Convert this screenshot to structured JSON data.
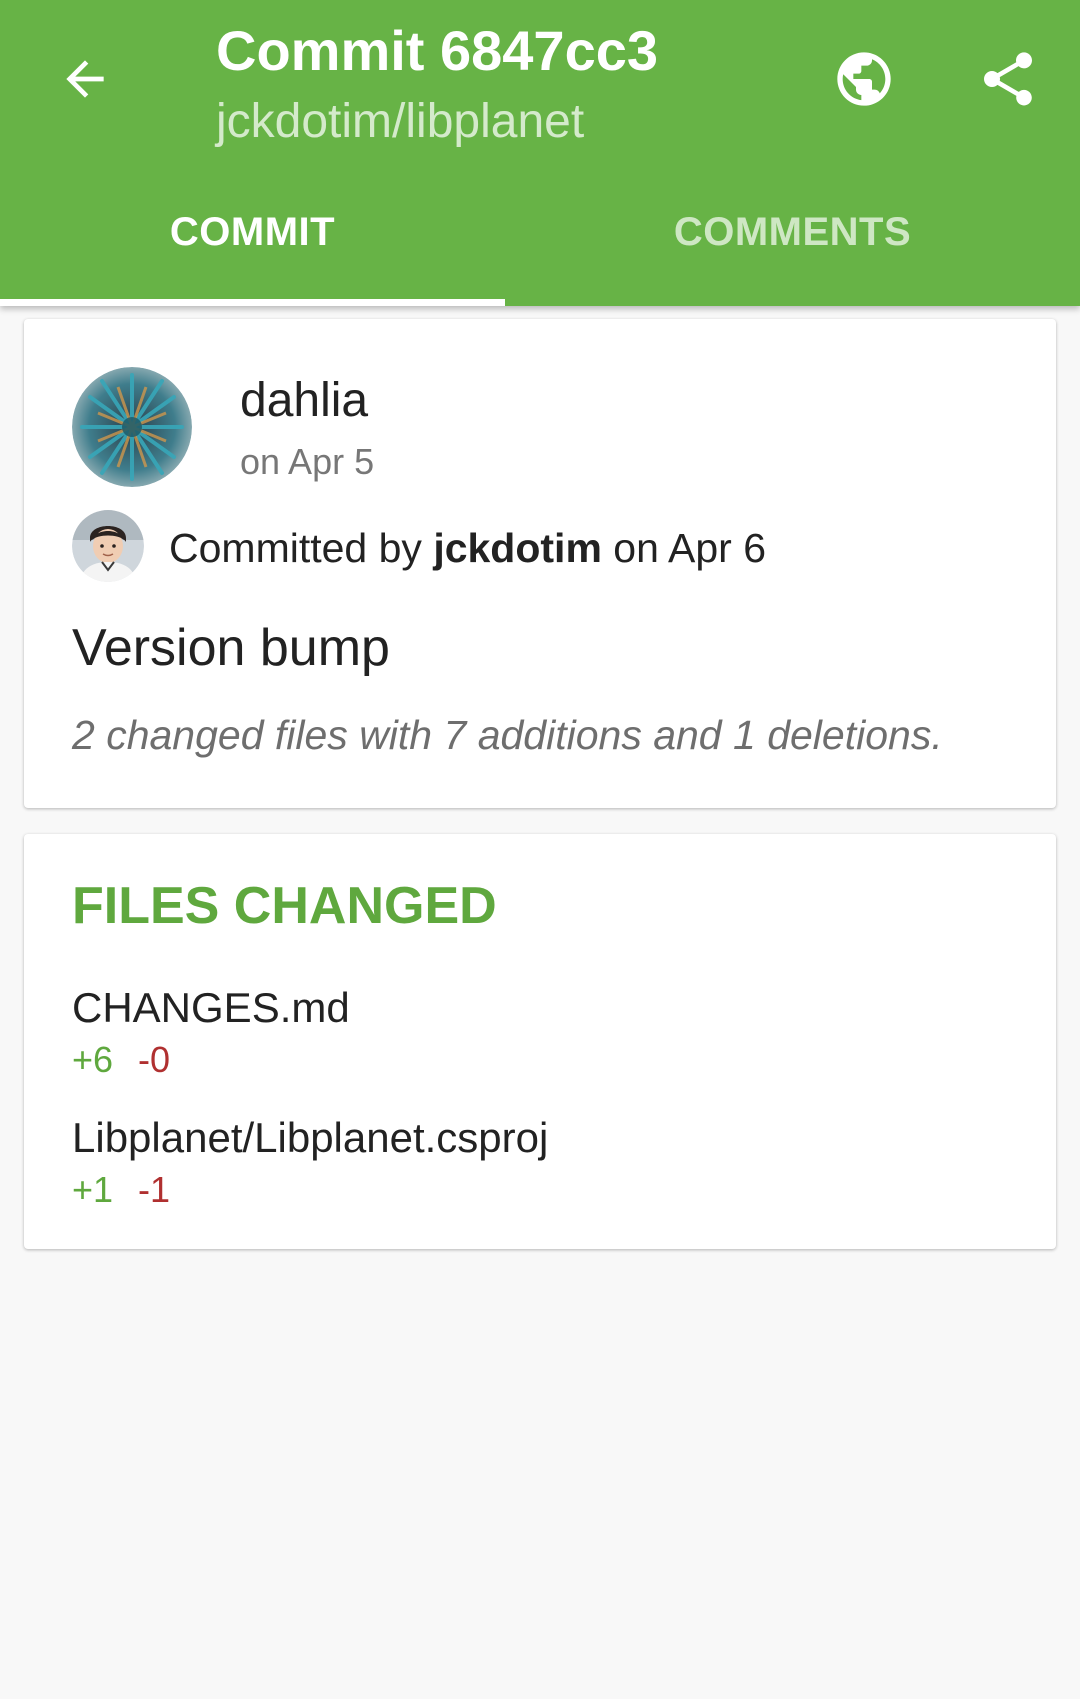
{
  "appbar": {
    "title": "Commit 6847cc3",
    "subtitle": "jckdotim/libplanet",
    "back_icon": "arrow-left-icon",
    "browser_icon": "globe-icon",
    "share_icon": "share-icon",
    "background_color": "#67b346"
  },
  "tabs": [
    {
      "label": "COMMIT",
      "selected": true
    },
    {
      "label": "COMMENTS",
      "selected": false
    }
  ],
  "commit": {
    "author": "dahlia",
    "author_date": "on Apr 5",
    "committed_prefix": "Committed by ",
    "committer": "jckdotim",
    "committed_suffix": " on Apr 6",
    "message": "Version bump",
    "stats": "2 changed files with 7 additions and 1 deletions."
  },
  "files_changed": {
    "heading": "FILES CHANGED",
    "files": [
      {
        "name": "CHANGES.md",
        "additions": "+6",
        "deletions": "-0"
      },
      {
        "name": "Libplanet/Libplanet.csproj",
        "additions": "+1",
        "deletions": "-1"
      }
    ]
  },
  "colors": {
    "accent": "#5fa83e",
    "addition": "#5fa83e",
    "deletion": "#b03030"
  }
}
